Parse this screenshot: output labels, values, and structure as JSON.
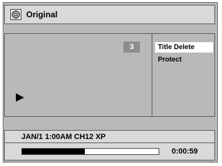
{
  "header": {
    "title": "Original",
    "icon": "disc-icon"
  },
  "preview": {
    "title_number": "3",
    "play_icon": "play-icon"
  },
  "menu": {
    "items": [
      {
        "label": "Title Delete",
        "selected": true
      },
      {
        "label": "Protect",
        "selected": false
      }
    ]
  },
  "status": {
    "info": "JAN/1  1:00AM  CH12  XP"
  },
  "playback": {
    "elapsed": "0:00:59",
    "progress_fraction": 0.46
  },
  "colors": {
    "background": "#b9b9b9",
    "panel": "#d9d9d9",
    "highlight": "#ffffff",
    "border": "#5c5c5c"
  }
}
